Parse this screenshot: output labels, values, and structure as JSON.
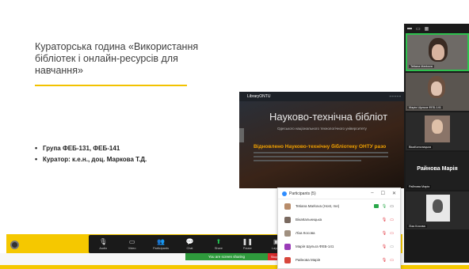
{
  "slide": {
    "title": "Кураторська година «Використання бібліотек і онлайн-ресурсів для навчання»",
    "bullets": [
      "Група ФЕБ-131, ФЕБ-141",
      "Куратор: к.е.н., доц. Маркова Т.Д."
    ]
  },
  "library_page": {
    "logo": "LibraryONTU",
    "heading": "Науково-технічна бібліот",
    "subheading": "Одеського національного технологічного університету",
    "banner": "Відновлено Науково-технічну бібліотеку ОНТУ разо"
  },
  "participants": {
    "title": "Participants (5)",
    "rows": [
      {
        "name": "Tetiana Markova (Host, me)"
      },
      {
        "name": "ВікаКальницька"
      },
      {
        "name": "Ліза Косова"
      },
      {
        "name": "Марія Шульга ФЕБ-141"
      },
      {
        "name": "Райнова Марія"
      }
    ]
  },
  "toolbar": {
    "items": [
      {
        "label": "Audio",
        "icon": "microphone-icon"
      },
      {
        "label": "Video",
        "icon": "video-camera-icon"
      },
      {
        "label": "Participants",
        "icon": "participants-icon",
        "count": "5"
      },
      {
        "label": "Chat",
        "icon": "chat-icon"
      },
      {
        "label": "Share",
        "icon": "share-icon"
      },
      {
        "label": "Pause",
        "icon": "pause-icon"
      },
      {
        "label": "Layout",
        "icon": "layout-icon"
      }
    ],
    "sharing_text": "You are screen sharing",
    "stop_label": "Stop"
  },
  "video_tiles": [
    {
      "name": "Tetiana Markova"
    },
    {
      "name": "Марія Шульга ФЕБ-141"
    },
    {
      "name": "ВікаКальницька"
    },
    {
      "name": "Райнова Марія",
      "big_name": "Райнова Марія"
    },
    {
      "name": "Ліза Косова"
    }
  ],
  "colors": {
    "accent_yellow": "#f5c800",
    "toolbar": "#1a1a1a",
    "sharing_green": "#2e9a3c",
    "stop_red": "#d72c2c"
  }
}
